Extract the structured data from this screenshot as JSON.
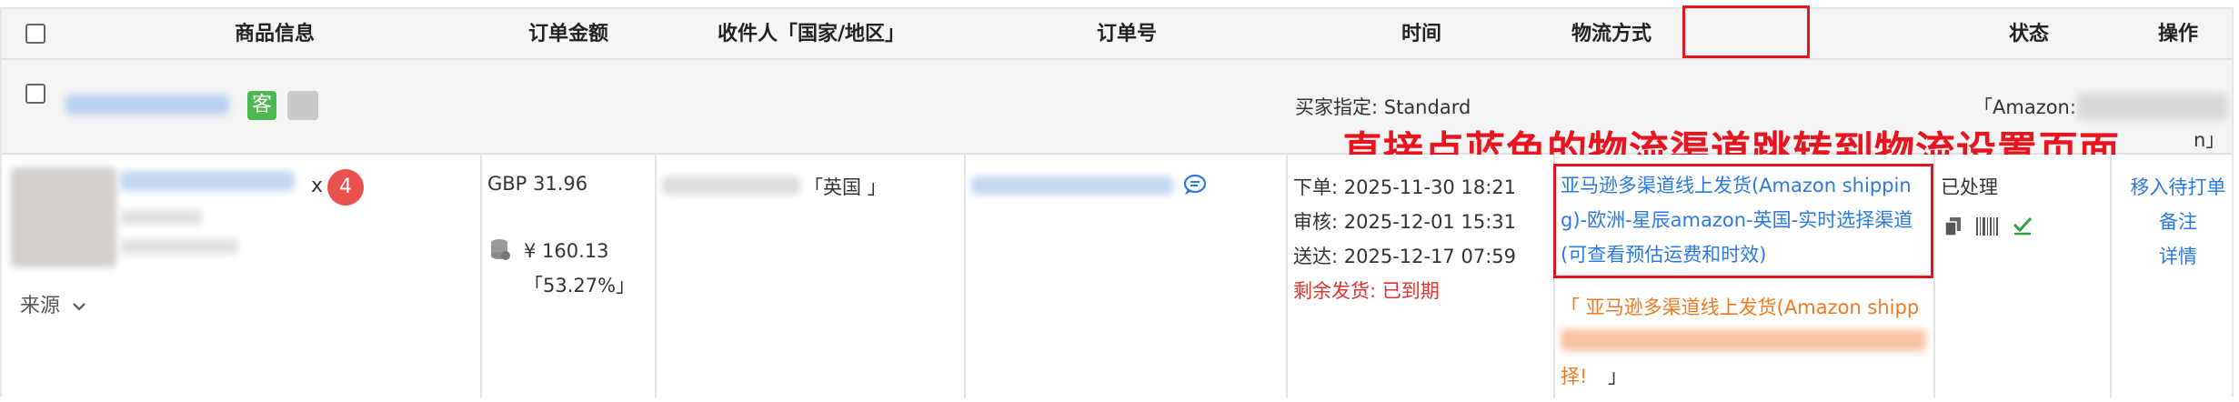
{
  "header": {
    "col_product": "商品信息",
    "col_amount": "订单金额",
    "col_recipient": "收件人「国家/地区」",
    "col_order_no": "订单号",
    "col_time": "时间",
    "col_logistics": "物流方式",
    "col_status": "状态",
    "col_action": "操作"
  },
  "order_header": {
    "customer_badge": "客",
    "buyer_specified": "买家指定:  Standard",
    "amazon_label": "「Amazon:",
    "amazon_tail": "n」"
  },
  "annotation": {
    "text": "直接点蓝色的物流渠道跳转到物流设置页面",
    "color": "#e8141e"
  },
  "product": {
    "qty_prefix": "x",
    "qty": "4",
    "source_label": "来源"
  },
  "amount": {
    "gbp": "GBP 31.96",
    "cny": "¥ 160.13",
    "percent": "「53.27%」"
  },
  "recipient": {
    "country": "「英国 」"
  },
  "time": {
    "ordered": "下单:  2025-11-30 18:21",
    "reviewed": "审核:  2025-12-01 15:31",
    "delivered": "送达:  2025-12-17 07:59",
    "remaining": "剩余发货:  已到期"
  },
  "logistics": {
    "channel_line1": "亚马逊多渠道线上发货(Amazon shippin",
    "channel_line2": "g)-欧洲-星辰amazon-英国-实时选择渠道",
    "channel_line3": "(可查看预估运费和时效)",
    "buyer_line1": "「 亚马逊多渠道线上发货(Amazon shipp",
    "buyer_line3": "择!",
    "buyer_close": "」"
  },
  "status": {
    "text": "已处理"
  },
  "actions": {
    "move_to_print": "移入待打单",
    "note": "备注",
    "details": "详情"
  }
}
